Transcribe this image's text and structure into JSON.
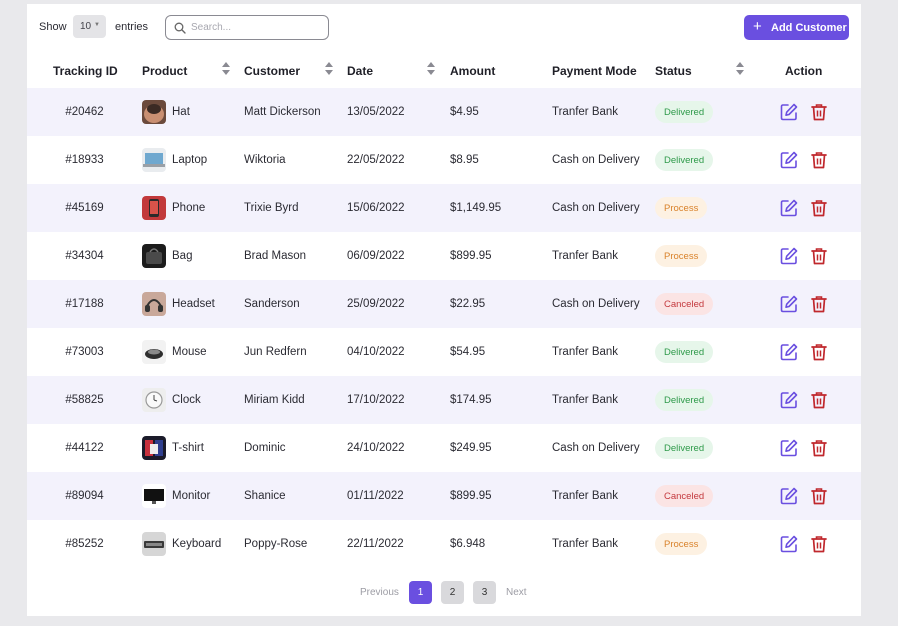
{
  "toolbar": {
    "show_label": "Show",
    "entries_value": "10",
    "entries_label": "entries",
    "search_placeholder": "Search...",
    "add_button_label": "Add Customer",
    "accent_color": "#6a4fe0"
  },
  "table": {
    "headers": {
      "tracking_id": "Tracking ID",
      "product": "Product",
      "customer": "Customer",
      "date": "Date",
      "amount": "Amount",
      "payment_mode": "Payment Mode",
      "status": "Status",
      "action": "Action"
    },
    "rows": [
      {
        "id": "#20462",
        "product": "Hat",
        "customer": "Matt Dickerson",
        "date": "13/05/2022",
        "amount": "$4.95",
        "payment": "Tranfer Bank",
        "status": "Delivered",
        "status_kind": "delivered",
        "thumb": "hat"
      },
      {
        "id": "#18933",
        "product": "Laptop",
        "customer": "Wiktoria",
        "date": "22/05/2022",
        "amount": "$8.95",
        "payment": "Cash on Delivery",
        "status": "Delivered",
        "status_kind": "delivered",
        "thumb": "laptop"
      },
      {
        "id": "#45169",
        "product": "Phone",
        "customer": "Trixie Byrd",
        "date": "15/06/2022",
        "amount": "$1,149.95",
        "payment": "Cash on Delivery",
        "status": "Process",
        "status_kind": "process",
        "thumb": "phone"
      },
      {
        "id": "#34304",
        "product": "Bag",
        "customer": "Brad Mason",
        "date": "06/09/2022",
        "amount": "$899.95",
        "payment": "Tranfer Bank",
        "status": "Process",
        "status_kind": "process",
        "thumb": "bag"
      },
      {
        "id": "#17188",
        "product": "Headset",
        "customer": "Sanderson",
        "date": "25/09/2022",
        "amount": "$22.95",
        "payment": "Cash on Delivery",
        "status": "Canceled",
        "status_kind": "canceled",
        "thumb": "headset"
      },
      {
        "id": "#73003",
        "product": "Mouse",
        "customer": "Jun Redfern",
        "date": "04/10/2022",
        "amount": "$54.95",
        "payment": "Tranfer Bank",
        "status": "Delivered",
        "status_kind": "delivered",
        "thumb": "mouse"
      },
      {
        "id": "#58825",
        "product": "Clock",
        "customer": "Miriam Kidd",
        "date": "17/10/2022",
        "amount": "$174.95",
        "payment": "Tranfer Bank",
        "status": "Delivered",
        "status_kind": "delivered",
        "thumb": "clock"
      },
      {
        "id": "#44122",
        "product": "T-shirt",
        "customer": "Dominic",
        "date": "24/10/2022",
        "amount": "$249.95",
        "payment": "Cash on Delivery",
        "status": "Delivered",
        "status_kind": "delivered",
        "thumb": "tshirt"
      },
      {
        "id": "#89094",
        "product": "Monitor",
        "customer": "Shanice",
        "date": "01/11/2022",
        "amount": "$899.95",
        "payment": "Tranfer Bank",
        "status": "Canceled",
        "status_kind": "canceled",
        "thumb": "monitor"
      },
      {
        "id": "#85252",
        "product": "Keyboard",
        "customer": "Poppy-Rose",
        "date": "22/11/2022",
        "amount": "$6.948",
        "payment": "Tranfer Bank",
        "status": "Process",
        "status_kind": "process",
        "thumb": "keyboard"
      }
    ],
    "status_colors": {
      "delivered": "#2e9a4a",
      "process": "#d9822b",
      "canceled": "#c4393e"
    },
    "edit_icon": "edit-icon",
    "delete_icon": "trash-icon",
    "edit_color": "#6a4fe0",
    "delete_color": "#c0282d"
  },
  "pagination": {
    "previous_label": "Previous",
    "next_label": "Next",
    "pages": [
      "1",
      "2",
      "3"
    ],
    "current_page": "1"
  }
}
